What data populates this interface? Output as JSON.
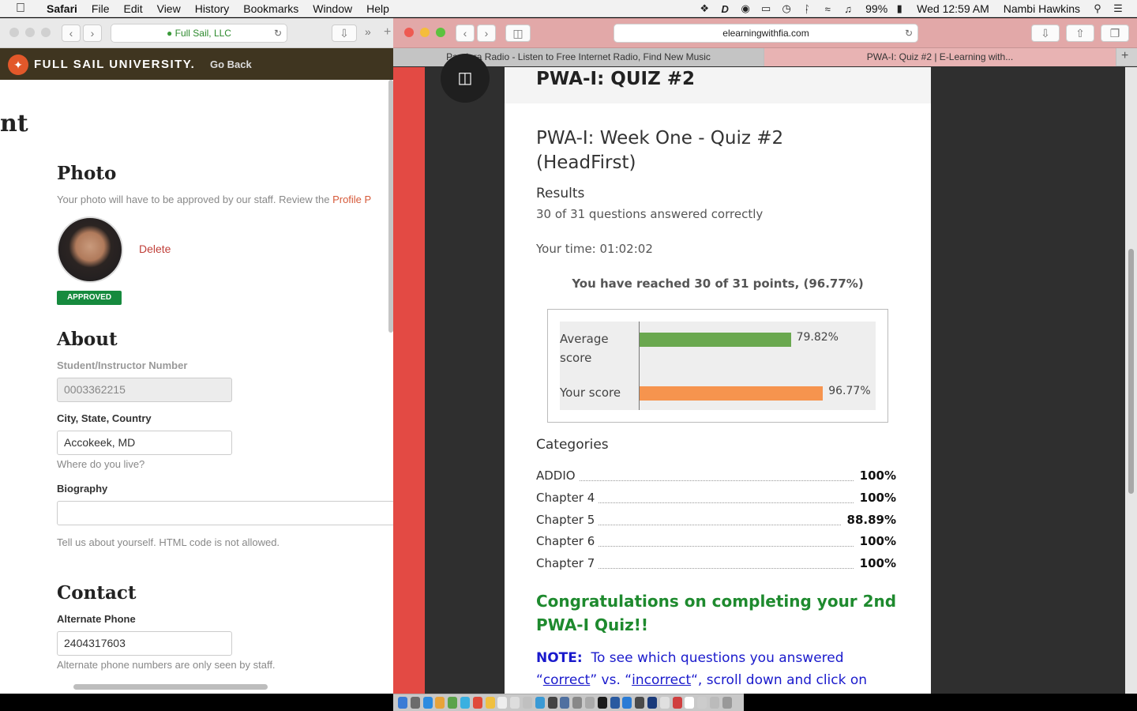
{
  "menubar": {
    "app": "Safari",
    "items": [
      "File",
      "Edit",
      "View",
      "History",
      "Bookmarks",
      "Window",
      "Help"
    ],
    "battery": "99%",
    "clock": "Wed 12:59 AM",
    "user": "Nambi Hawkins"
  },
  "left": {
    "url": "Full Sail, LLC",
    "brand": "FULL SAIL UNIVERSITY.",
    "go_back": "Go Back",
    "partial_heading": "nt",
    "photo": {
      "heading": "Photo",
      "hint": "Your photo will have to be approved by our staff. Review the ",
      "hint_link": "Profile P",
      "delete": "Delete",
      "badge": "APPROVED"
    },
    "about": {
      "heading": "About",
      "number_label": "Student/Instructor Number",
      "number_value": "0003362215",
      "city_label": "City, State, Country",
      "city_value": "Accokeek, MD",
      "city_hint": "Where do you live?",
      "bio_label": "Biography",
      "bio_value": "",
      "bio_hint": "Tell us about yourself. HTML code is not allowed."
    },
    "contact": {
      "heading": "Contact",
      "phone_label": "Alternate Phone",
      "phone_value": "2404317603",
      "phone_hint": "Alternate phone numbers are only seen by staff."
    }
  },
  "right": {
    "url": "elearningwithfia.com",
    "tabs": [
      "Pandora Radio - Listen to Free Internet Radio, Find New Music",
      "PWA-I: Quiz #2 | E-Learning with..."
    ],
    "page_title": "PWA-I: QUIZ #2",
    "quiz_title": "PWA-I: Week One - Quiz #2 (HeadFirst)",
    "results_heading": "Results",
    "answered": "30 of 31 questions answered correctly",
    "time": "Your time: 01:02:02",
    "points": "You have reached 30 of 31 points, (96.77%)",
    "categories_heading": "Categories",
    "categories": [
      {
        "name": "ADDIO",
        "pct": "100%"
      },
      {
        "name": "Chapter 4",
        "pct": "100%"
      },
      {
        "name": "Chapter 5",
        "pct": "88.89%"
      },
      {
        "name": "Chapter 6",
        "pct": "100%"
      },
      {
        "name": "Chapter 7",
        "pct": "100%"
      }
    ],
    "congrats": "Congratulations on completing your 2nd PWA-I Quiz!!",
    "note_label": "NOTE:",
    "note_text": "To see which questions you answered",
    "note_q1": "“",
    "note_correct": "correct",
    "note_mid": "” vs. “",
    "note_incorrect": "incorrect",
    "note_end": "“, scroll down and click on"
  },
  "chart_data": {
    "type": "bar",
    "orientation": "horizontal",
    "categories": [
      "Average score",
      "Your score"
    ],
    "values": [
      79.82,
      96.77
    ],
    "data_labels": [
      "79.82%",
      "96.77%"
    ],
    "colors": [
      "#6aa84f",
      "#f6944e"
    ],
    "xlim": [
      0,
      100
    ]
  }
}
